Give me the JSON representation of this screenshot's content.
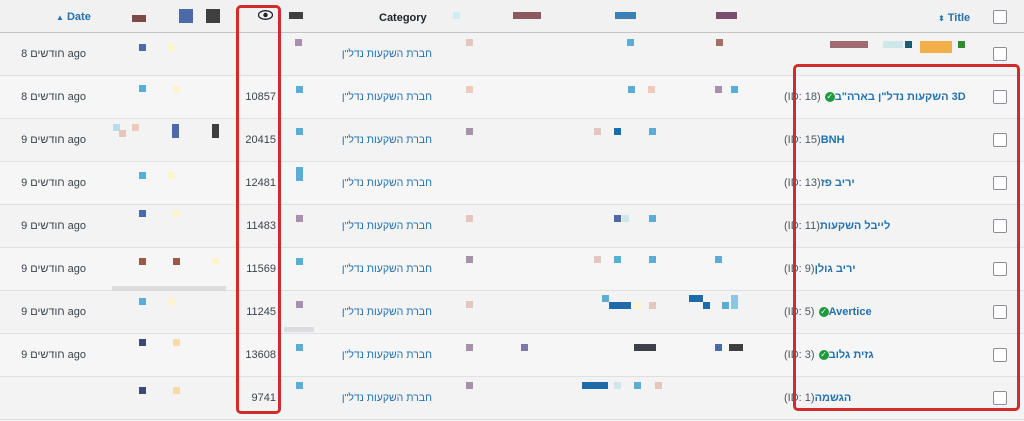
{
  "columns": {
    "date_label": "Date",
    "date_sort_icon": "caret-up-icon",
    "views_icon": "eye-icon",
    "category_label": "Category",
    "title_label": "Title",
    "title_sort_icon": "sort-arrows-icon"
  },
  "rows": [
    {
      "date": "8 חודשים ago",
      "views": "",
      "category": "חברת השקעות נדל\"ן",
      "title": "",
      "id": "",
      "verified": false
    },
    {
      "date": "8 חודשים ago",
      "views": "10857",
      "category": "חברת השקעות נדל\"ן",
      "title": "3D השקעות נדל\"ן בארה\"ב",
      "id": "(ID: 18)",
      "verified": true
    },
    {
      "date": "9 חודשים ago",
      "views": "20415",
      "category": "חברת השקעות נדל\"ן",
      "title": "BNH",
      "id": "(ID: 15)",
      "verified": false
    },
    {
      "date": "9 חודשים ago",
      "views": "12481",
      "category": "חברת השקעות נדל\"ן",
      "title": "יריב פז",
      "id": "(ID: 13)",
      "verified": false
    },
    {
      "date": "9 חודשים ago",
      "views": "11483",
      "category": "חברת השקעות נדל\"ן",
      "title": "לייבל השקעות",
      "id": "(ID: 11)",
      "verified": false
    },
    {
      "date": "9 חודשים ago",
      "views": "11569",
      "category": "חברת השקעות נדל\"ן",
      "title": "יריב גולן",
      "id": "(ID: 9)",
      "verified": false
    },
    {
      "date": "9 חודשים ago",
      "views": "11245",
      "category": "חברת השקעות נדל\"ן",
      "title": "Avertice",
      "id": "(ID: 5)",
      "verified": true
    },
    {
      "date": "9 חודשים ago",
      "views": "13608",
      "category": "חברת השקעות נדל\"ן",
      "title": "גזית גלוב",
      "id": "(ID: 3)",
      "verified": true
    },
    {
      "date": "",
      "views": "9741",
      "category": "חברת השקעות נדל\"ן",
      "title": "הגשמה",
      "id": "(ID: 1)",
      "verified": false
    }
  ],
  "colors": {
    "highlight": "#d12b2b",
    "link": "#2271b1",
    "verified": "#1e9a3c"
  }
}
